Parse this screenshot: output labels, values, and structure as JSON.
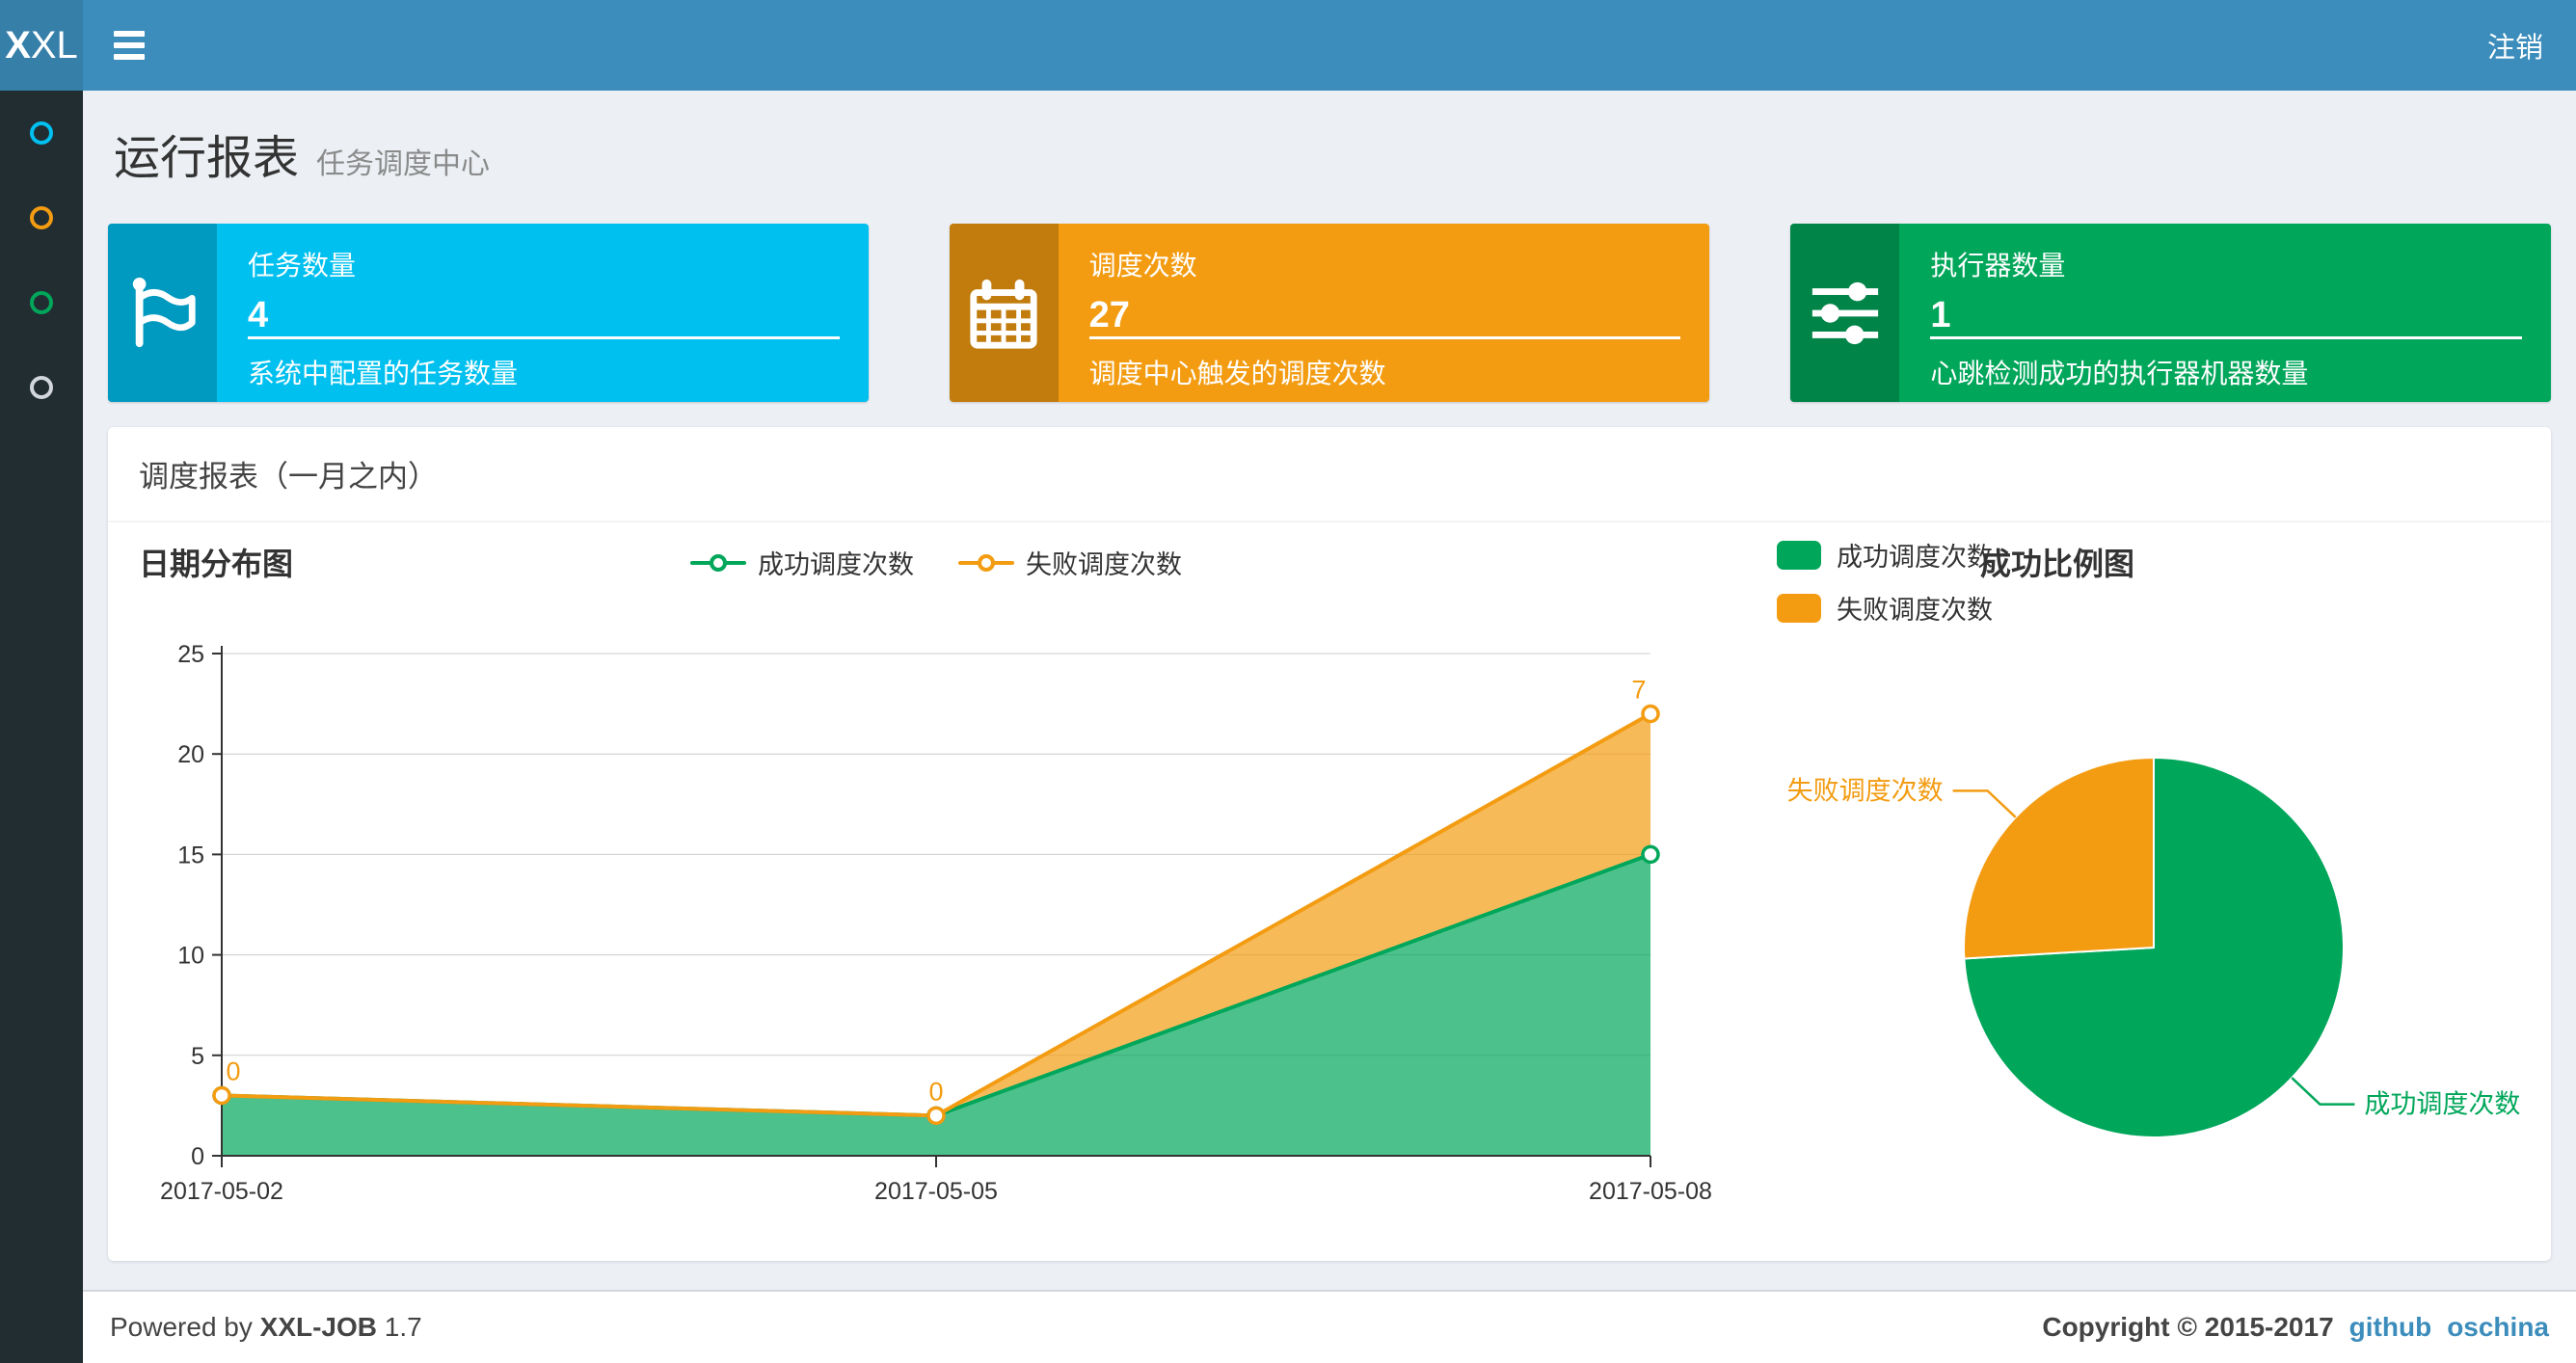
{
  "header": {
    "logo_bold": "X",
    "logo_rest": "XL",
    "logout_label": "注销"
  },
  "sidebar": {
    "items": [
      {
        "name": "menu-dashboard",
        "color": "#00c0ef"
      },
      {
        "name": "menu-job-manage",
        "color": "#f39c12"
      },
      {
        "name": "menu-job-log",
        "color": "#00a65a"
      },
      {
        "name": "menu-executor-manage",
        "color": "#d2d6de"
      }
    ]
  },
  "page": {
    "title": "运行报表",
    "subtitle": "任务调度中心"
  },
  "stat_cards": [
    {
      "icon": "flag-icon",
      "label": "任务数量",
      "value": "4",
      "desc": "系统中配置的任务数量",
      "color": "#00c0ef"
    },
    {
      "icon": "calendar-icon",
      "label": "调度次数",
      "value": "27",
      "desc": "调度中心触发的调度次数",
      "color": "#f39c12"
    },
    {
      "icon": "sliders-icon",
      "label": "执行器数量",
      "value": "1",
      "desc": "心跳检测成功的执行器机器数量",
      "color": "#00a65a"
    }
  ],
  "panel": {
    "title": "调度报表（一月之内）"
  },
  "chart_data": [
    {
      "type": "area",
      "title": "日期分布图",
      "stacked": true,
      "categories": [
        "2017-05-02",
        "2017-05-05",
        "2017-05-08"
      ],
      "series": [
        {
          "name": "成功调度次数",
          "color": "#00a65a",
          "values": [
            3,
            2,
            15
          ],
          "show_labels": false
        },
        {
          "name": "失败调度次数",
          "color": "#f39c12",
          "values": [
            0,
            0,
            7
          ],
          "show_labels": true
        }
      ],
      "ylim": [
        0,
        25
      ],
      "ytick_step": 5,
      "grid": true,
      "legend_position": "top-center",
      "area_opacity": 0.7
    },
    {
      "type": "pie",
      "title": "成功比例图",
      "slices": [
        {
          "name": "成功调度次数",
          "value": 20,
          "color": "#00a65a"
        },
        {
          "name": "失败调度次数",
          "value": 7,
          "color": "#f39c12"
        }
      ],
      "legend_position": "top-left"
    }
  ],
  "footer": {
    "powered_prefix": "Powered by",
    "brand": "XXL-JOB",
    "version": "1.7",
    "copyright": "Copyright © 2015-2017",
    "links": [
      {
        "label": "github"
      },
      {
        "label": "oschina"
      }
    ]
  }
}
